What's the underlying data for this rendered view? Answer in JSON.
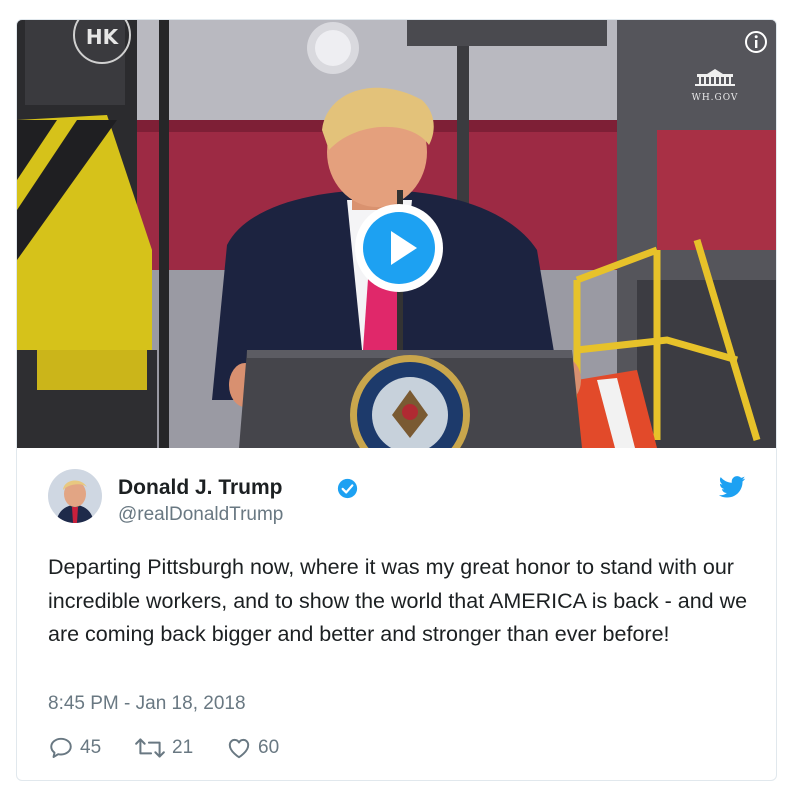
{
  "media": {
    "watermark": "WH.GOV",
    "seal_text": "PRESIDENT OF THE UNITED",
    "corner_logo_text": "HK",
    "icons": {
      "info": "info-icon",
      "play": "play-icon",
      "watermark": "white-house-icon"
    }
  },
  "author": {
    "name": "Donald J. Trump",
    "handle": "@realDonaldTrump",
    "verified": true
  },
  "tweet": {
    "text": "Departing Pittsburgh now, where it was my great honor to stand with our incredible workers, and to show the world that AMERICA is back - and we are coming back bigger and better and stronger than ever before!",
    "timestamp": "8:45 PM - Jan 18, 2018"
  },
  "actions": {
    "replies": "45",
    "retweets": "21",
    "likes": "60"
  },
  "colors": {
    "brand_blue": "#1da1f2",
    "text": "#1c2022",
    "muted": "#697882",
    "border": "#e1e8ed"
  }
}
